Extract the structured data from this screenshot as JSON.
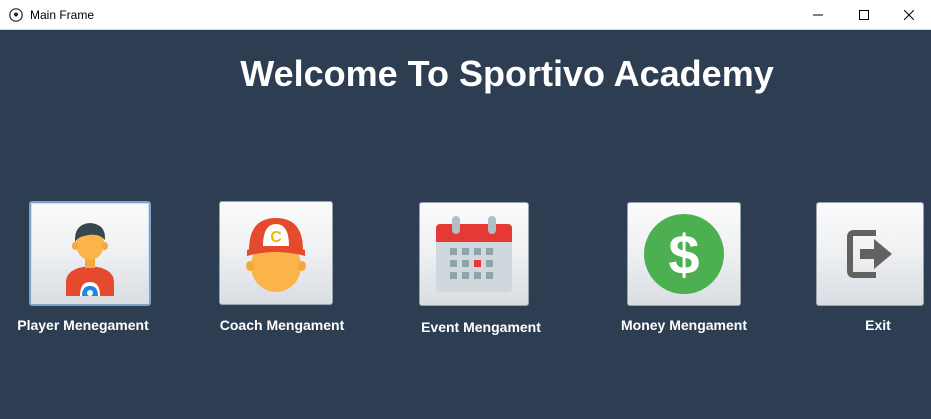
{
  "window": {
    "title": "Main Frame",
    "app_icon": "soccer-ball-icon",
    "controls": [
      "minimize-icon",
      "maximize-icon",
      "close-icon"
    ]
  },
  "main": {
    "heading": "Welcome To Sportivo Academy",
    "background_color": "#2e3e52",
    "menu": [
      {
        "label": "Player Menegament",
        "icon": "player-icon",
        "focused": true
      },
      {
        "label": "Coach Mengament",
        "icon": "coach-icon",
        "focused": false
      },
      {
        "label": "Event Mengament",
        "icon": "calendar-icon",
        "focused": false
      },
      {
        "label": "Money Mengament",
        "icon": "dollar-icon",
        "focused": false
      },
      {
        "label": "Exit",
        "icon": "exit-icon",
        "focused": false
      }
    ]
  }
}
